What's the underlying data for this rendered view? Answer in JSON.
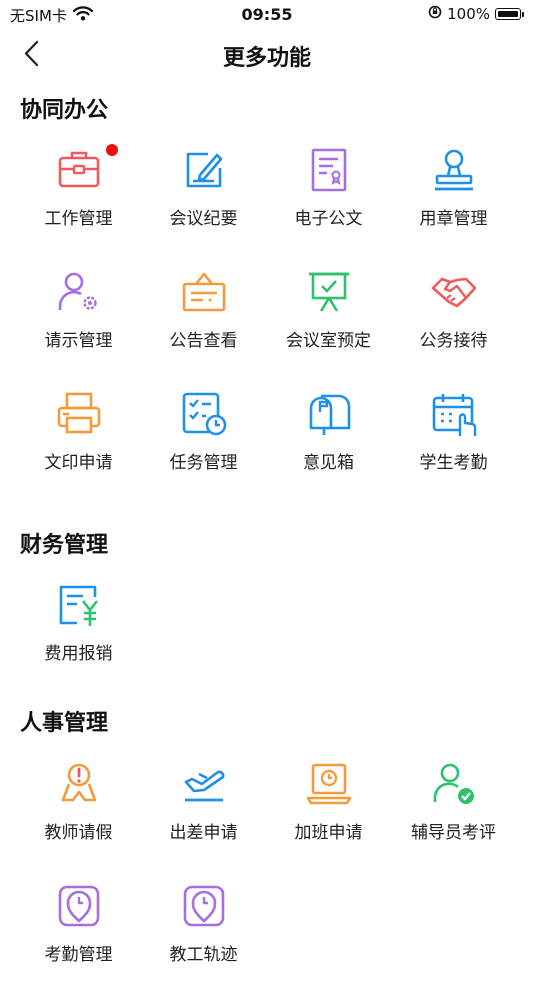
{
  "status": {
    "carrier": "无SIM卡",
    "time": "09:55",
    "battery": "100%"
  },
  "nav": {
    "title": "更多功能"
  },
  "sections": [
    {
      "title": "协同办公",
      "items": [
        {
          "label": "工作管理",
          "icon": "briefcase-icon",
          "badge": true
        },
        {
          "label": "会议纪要",
          "icon": "meeting-notes-icon"
        },
        {
          "label": "电子公文",
          "icon": "document-certificate-icon"
        },
        {
          "label": "用章管理",
          "icon": "stamp-icon"
        },
        {
          "label": "请示管理",
          "icon": "user-gear-icon"
        },
        {
          "label": "公告查看",
          "icon": "notice-board-icon"
        },
        {
          "label": "会议室预定",
          "icon": "presentation-board-icon"
        },
        {
          "label": "公务接待",
          "icon": "handshake-icon"
        },
        {
          "label": "文印申请",
          "icon": "printer-icon"
        },
        {
          "label": "任务管理",
          "icon": "task-checklist-icon"
        },
        {
          "label": "意见箱",
          "icon": "mailbox-icon"
        },
        {
          "label": "学生考勤",
          "icon": "calendar-touch-icon"
        }
      ]
    },
    {
      "title": "财务管理",
      "items": [
        {
          "label": "费用报销",
          "icon": "expense-yuan-icon"
        }
      ]
    },
    {
      "title": "人事管理",
      "items": [
        {
          "label": "教师请假",
          "icon": "teacher-leave-icon"
        },
        {
          "label": "出差申请",
          "icon": "airplane-icon"
        },
        {
          "label": "加班申请",
          "icon": "overtime-laptop-icon"
        },
        {
          "label": "辅导员考评",
          "icon": "user-check-icon"
        },
        {
          "label": "考勤管理",
          "icon": "clock-location-icon"
        },
        {
          "label": "教工轨迹",
          "icon": "clock-location-icon"
        }
      ]
    }
  ],
  "colors": {
    "red": "#f05a5a",
    "blue": "#1e90e8",
    "purple": "#a66ee0",
    "orange": "#f39a3c",
    "green": "#2fc26e",
    "badge": "#ee1111"
  }
}
